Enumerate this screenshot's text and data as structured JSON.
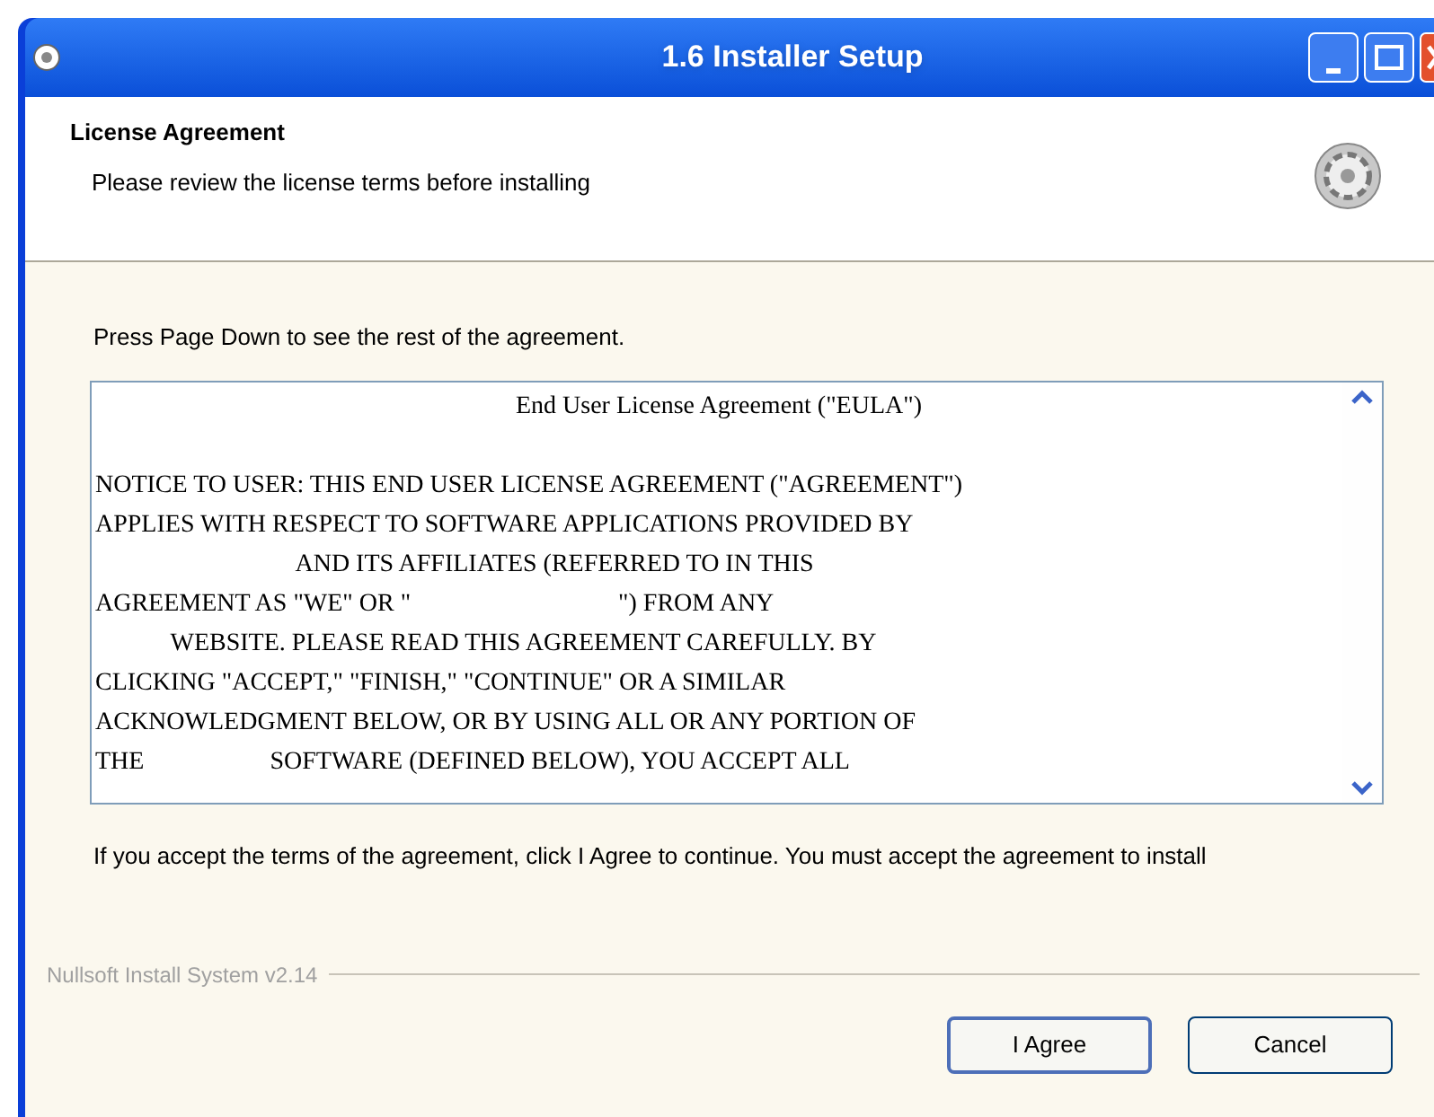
{
  "window": {
    "title": "1.6 Installer Setup"
  },
  "header": {
    "title": "License Agreement",
    "subtitle": "Please review the license terms before installing"
  },
  "instruction": "Press Page Down to see the rest of the agreement.",
  "license_text": {
    "heading": "End User License Agreement (\"EULA\")",
    "lines": [
      "NOTICE TO USER: THIS END USER LICENSE AGREEMENT (\"AGREEMENT\")",
      "APPLIES WITH RESPECT TO SOFTWARE APPLICATIONS PROVIDED BY",
      "                                AND ITS AFFILIATES (REFERRED TO IN THIS",
      "AGREEMENT AS \"WE\" OR \"                                 \") FROM ANY",
      "            WEBSITE. PLEASE READ THIS AGREEMENT CAREFULLY. BY",
      "CLICKING \"ACCEPT,\" \"FINISH,\" \"CONTINUE\" OR A SIMILAR",
      "ACKNOWLEDGMENT BELOW, OR BY USING ALL OR ANY PORTION OF",
      "THE                    SOFTWARE (DEFINED BELOW), YOU ACCEPT ALL"
    ]
  },
  "footer_text": "If you accept the terms of the agreement, click I Agree to continue. You must accept the agreement to install",
  "branding": "Nullsoft Install System v2.14",
  "buttons": [
    {
      "label": "I Agree",
      "default": true
    },
    {
      "label": "Cancel",
      "default": false
    }
  ]
}
